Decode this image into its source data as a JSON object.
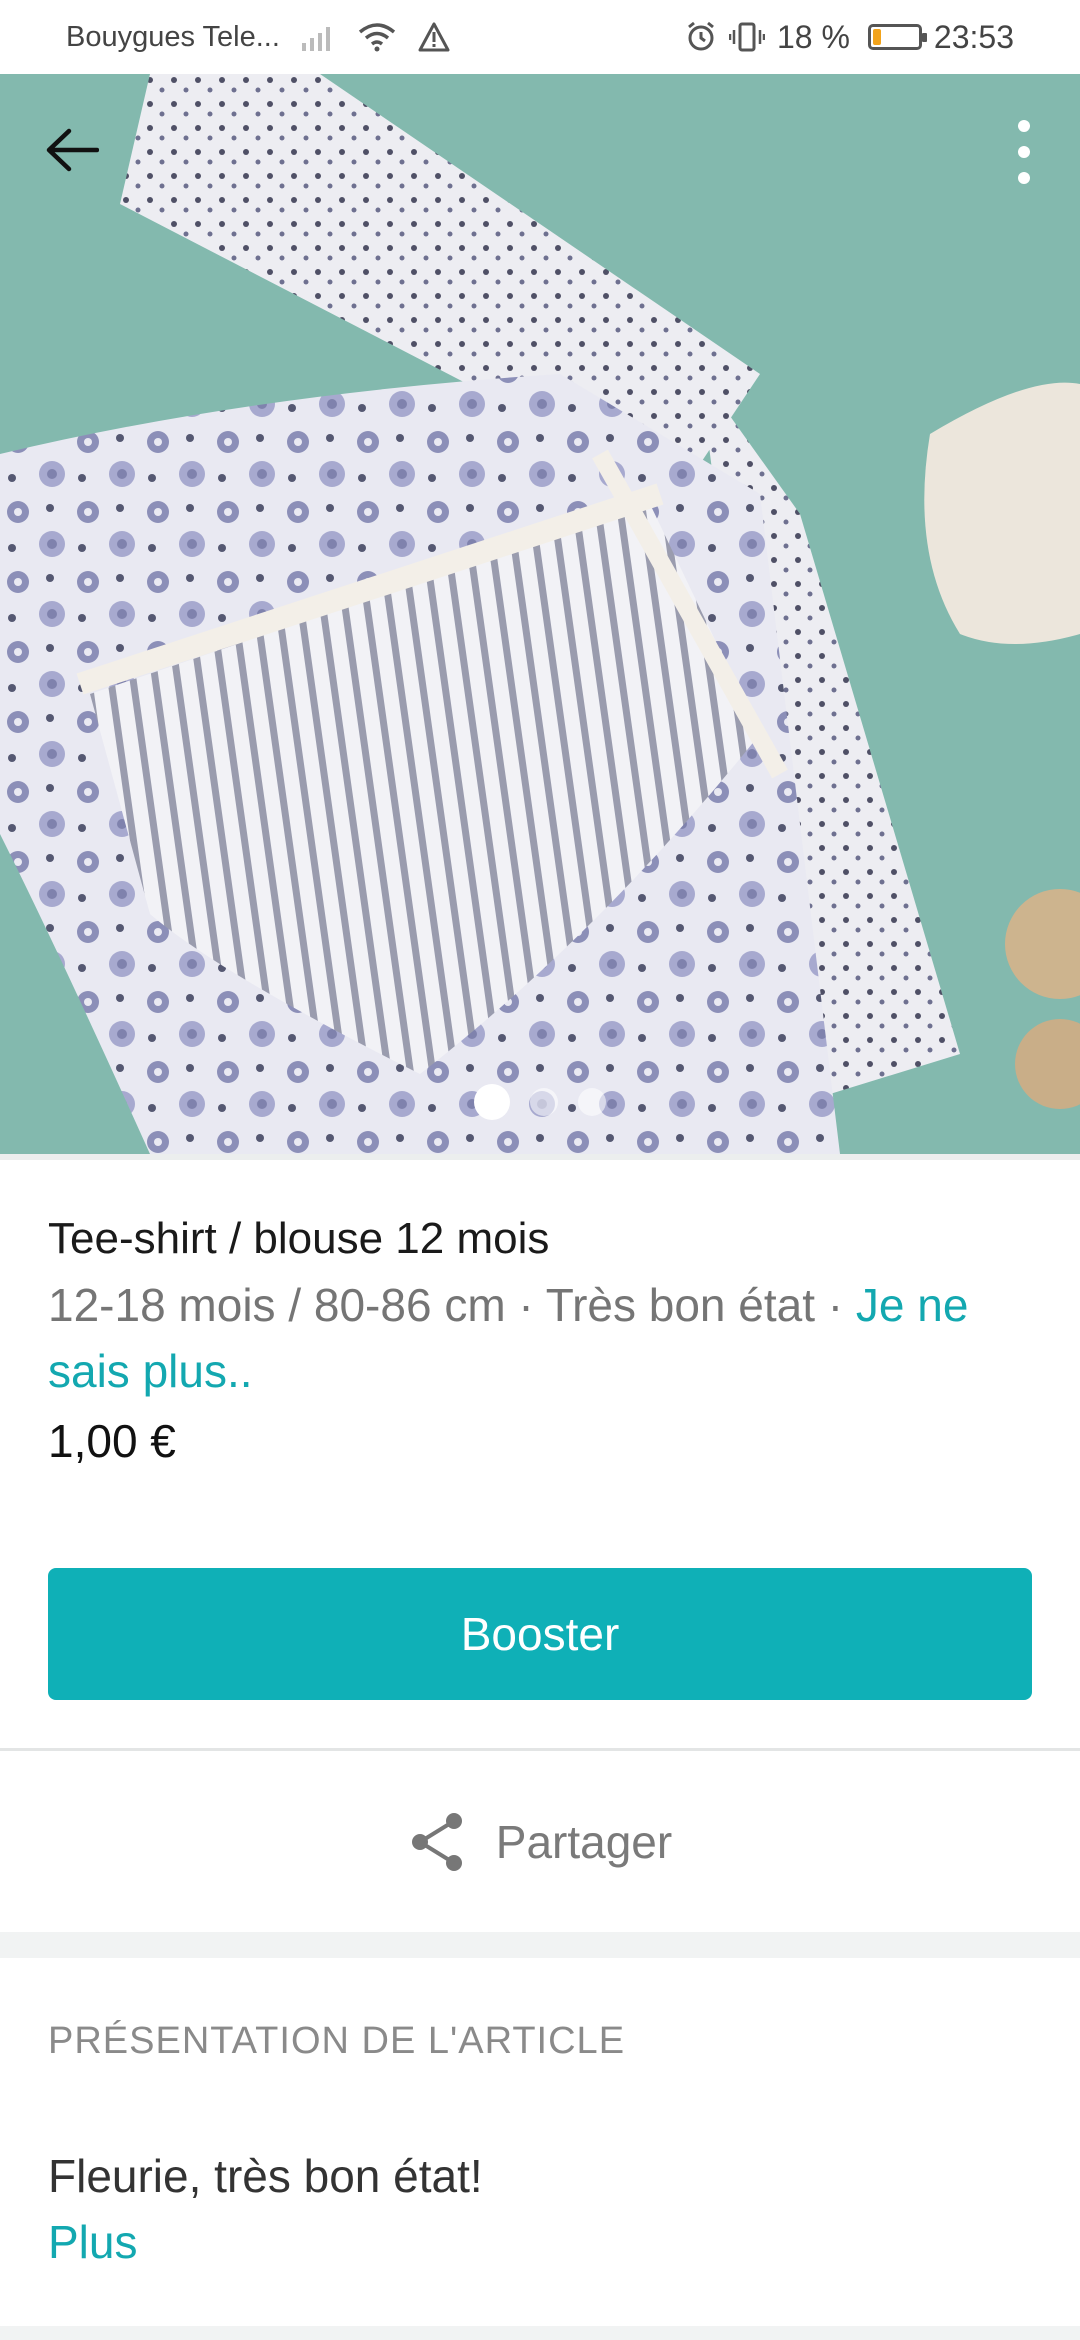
{
  "status_bar": {
    "carrier": "Bouygues Tele...",
    "battery": "18 %",
    "battery_level": 0.18,
    "time": "23:53"
  },
  "hero": {
    "image_count": 3,
    "active_index": 0,
    "colors": {
      "background": "#7fb5ab"
    }
  },
  "item": {
    "title": "Tee-shirt / blouse 12 mois",
    "meta_plain": "12-18 mois / 80-86 cm · Très bon état · ",
    "meta_link": "Je ne sais plus..",
    "price": "1,00 €"
  },
  "actions": {
    "booster_label": "Booster",
    "share_label": "Partager"
  },
  "presentation": {
    "section_title": "PRÉSENTATION DE L'ARTICLE",
    "description": "Fleurie, très bon état!",
    "more_label": "Plus"
  },
  "colors": {
    "accent": "#0fb0b7",
    "link": "#13a8b0"
  }
}
